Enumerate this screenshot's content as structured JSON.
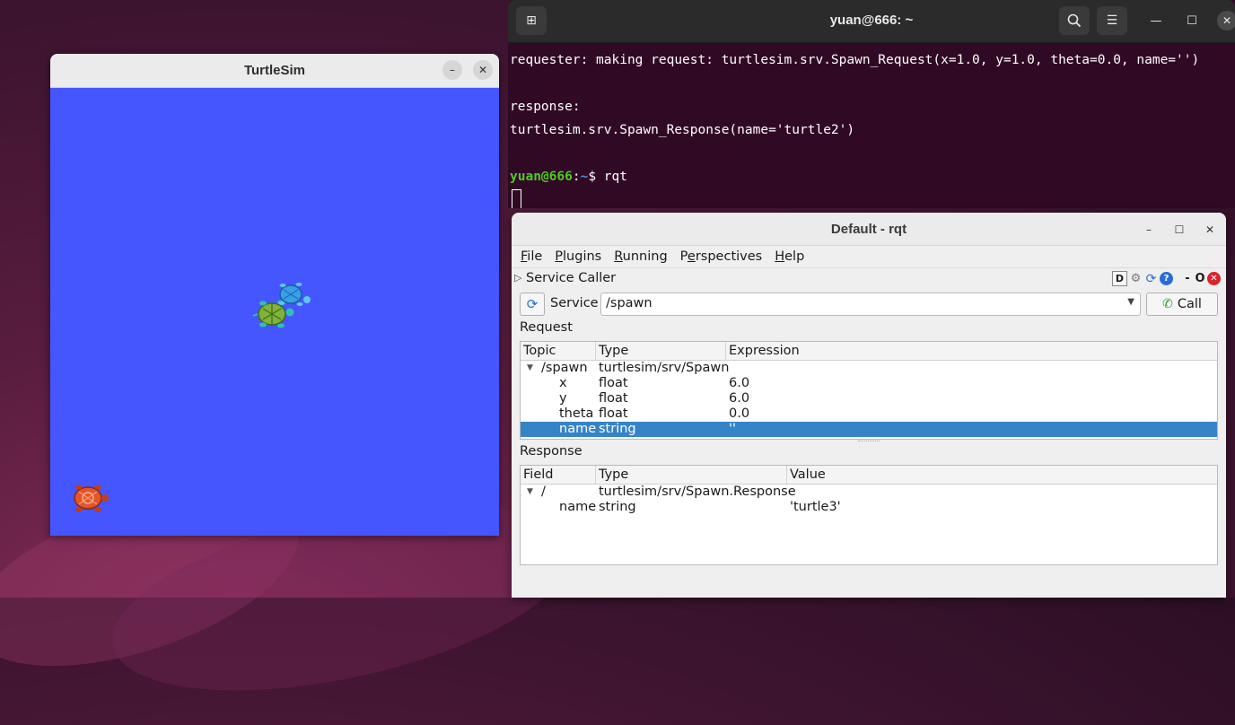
{
  "terminal": {
    "title": "yuan@666: ~",
    "lines": [
      "requester: making request: turtlesim.srv.Spawn_Request(x=1.0, y=1.0, theta=0.0, name='')",
      "",
      "response:",
      "turtlesim.srv.Spawn_Response(name='turtle2')",
      ""
    ],
    "prompt_user": "yuan@666",
    "prompt_sep": ":",
    "prompt_path": "~",
    "prompt_cmd": "$ rqt"
  },
  "turtlesim": {
    "title": "TurtleSim",
    "background_color": "#4556ff"
  },
  "rqt": {
    "title": "Default - rqt",
    "menu": [
      {
        "label": "File",
        "mnemonic": "F",
        "rest": "ile"
      },
      {
        "label": "Plugins",
        "mnemonic": "P",
        "rest": "lugins"
      },
      {
        "label": "Running",
        "mnemonic": "R",
        "rest": "unning"
      },
      {
        "label": "Perspectives",
        "mnemonic": "e",
        "pre": "P",
        "rest": "rspectives"
      },
      {
        "label": "Help",
        "mnemonic": "H",
        "rest": "elp"
      }
    ],
    "plugin": {
      "title": "Service Caller",
      "icon_d": "D",
      "dash": "-",
      "o": "O"
    },
    "service": {
      "label": "Service",
      "value": "/spawn",
      "call_label": "Call"
    },
    "request": {
      "label": "Request",
      "columns": [
        "Topic",
        "Type",
        "Expression"
      ],
      "rows": [
        {
          "topic": "/spawn",
          "type": "turtlesim/srv/Spawn",
          "expr": "",
          "level": 0,
          "expanded": true
        },
        {
          "topic": "x",
          "type": "float",
          "expr": "6.0",
          "level": 1
        },
        {
          "topic": "y",
          "type": "float",
          "expr": "6.0",
          "level": 1
        },
        {
          "topic": "theta",
          "type": "float",
          "expr": "0.0",
          "level": 1
        },
        {
          "topic": "name",
          "type": "string",
          "expr": "''",
          "level": 1,
          "selected": true
        }
      ]
    },
    "response": {
      "label": "Response",
      "columns": [
        "Field",
        "Type",
        "Value"
      ],
      "rows": [
        {
          "field": "/",
          "type": "turtlesim/srv/Spawn.Response",
          "value": "",
          "level": 0,
          "expanded": true
        },
        {
          "field": "name",
          "type": "string",
          "value": "'turtle3'",
          "level": 1
        }
      ]
    }
  }
}
